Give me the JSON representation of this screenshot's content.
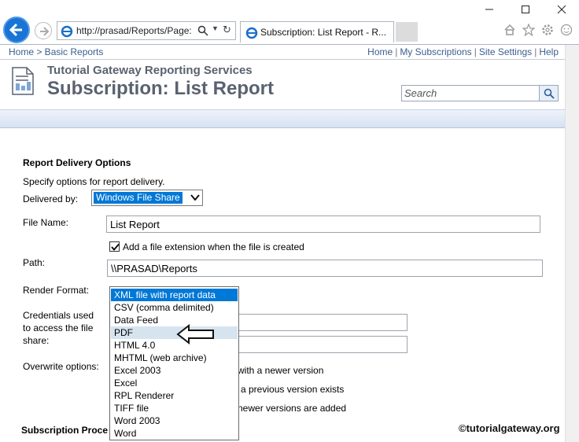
{
  "browser": {
    "url": "http://prasad/Reports/Page:",
    "tab_title": "Subscription: List Report - R..."
  },
  "topbar": {
    "breadcrumb": "Home > Basic Reports",
    "links": [
      "Home",
      "My Subscriptions",
      "Site Settings",
      "Help"
    ],
    "separator": "|"
  },
  "header": {
    "site_name": "Tutorial Gateway Reporting Services",
    "page_title": "Subscription: List Report",
    "search_placeholder": "Search"
  },
  "form": {
    "section_title": "Report Delivery Options",
    "instructions": "Specify options for report delivery.",
    "delivered_by_label": "Delivered by:",
    "delivered_by_value": "Windows File Share",
    "file_name_label": "File Name:",
    "file_name_value": "List Report",
    "add_extension_label": "Add a file extension when the file is created",
    "add_extension_checked": true,
    "path_label": "Path:",
    "path_value": "\\\\PRASAD\\Reports",
    "render_format_label": "Render Format:",
    "render_formats": [
      "XML file with report data",
      "CSV (comma delimited)",
      "Data Feed",
      "PDF",
      "HTML 4.0",
      "MHTML (web archive)",
      "Excel 2003",
      "Excel",
      "RPL Renderer",
      "TIFF file",
      "Word 2003",
      "Word"
    ],
    "render_format_selected": "XML file with report data",
    "render_format_hover": "PDF",
    "credentials_label_line1": "Credentials used",
    "credentials_label_line2": "to access the file",
    "credentials_label_line3": "share:",
    "overwrite_label": "Overwrite options:",
    "overwrite_opt1_tail": "with a newer version",
    "overwrite_opt2_tail": "a previous version exists",
    "overwrite_opt3_tail": "newer versions are added",
    "subscription_processing_label": "Subscription Proce"
  },
  "watermark": "©tutorialgateway.org",
  "colors": {
    "selection_blue": "#0078d7",
    "link_blue": "#3b5f8f",
    "title_gray": "#5a6270"
  }
}
